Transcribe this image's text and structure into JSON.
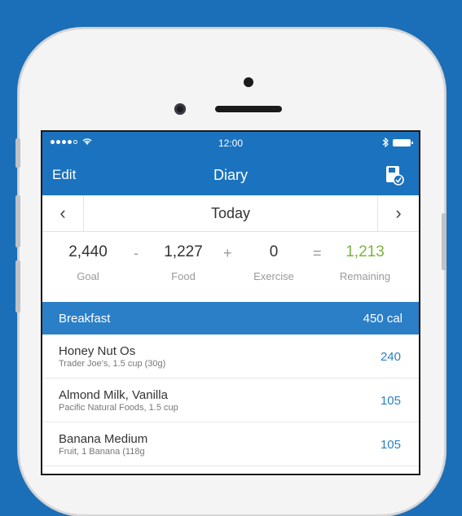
{
  "status_bar": {
    "time": "12:00",
    "signal_icon": "signal-dots",
    "wifi_icon": "wifi-icon",
    "bluetooth_icon": "bluetooth-icon",
    "battery_icon": "battery-icon"
  },
  "nav": {
    "edit_label": "Edit",
    "title": "Diary",
    "save_icon": "save-icon"
  },
  "date_nav": {
    "date": "Today",
    "prev": "‹",
    "next": "›"
  },
  "summary": {
    "goal": {
      "value": "2,440",
      "label": "Goal"
    },
    "food": {
      "value": "1,227",
      "label": "Food"
    },
    "exercise": {
      "value": "0",
      "label": "Exercise"
    },
    "remaining": {
      "value": "1,213",
      "label": "Remaining"
    },
    "ops": {
      "minus": "-",
      "plus": "+",
      "equals": "="
    }
  },
  "breakfast": {
    "name": "Breakfast",
    "calories": "450 cal",
    "items": [
      {
        "name": "Honey Nut Os",
        "detail": "Trader Joe's, 1.5 cup (30g)",
        "calories": "240"
      },
      {
        "name": "Almond Milk, Vanilla",
        "detail": "Pacific  Natural Foods, 1.5 cup",
        "calories": "105"
      },
      {
        "name": "Banana Medium",
        "detail": "Fruit, 1 Banana (118g",
        "calories": "105"
      }
    ]
  },
  "colors": {
    "brand_blue": "#1b73bf",
    "section_blue": "#2b7fc7",
    "remaining_green": "#7cb342"
  }
}
